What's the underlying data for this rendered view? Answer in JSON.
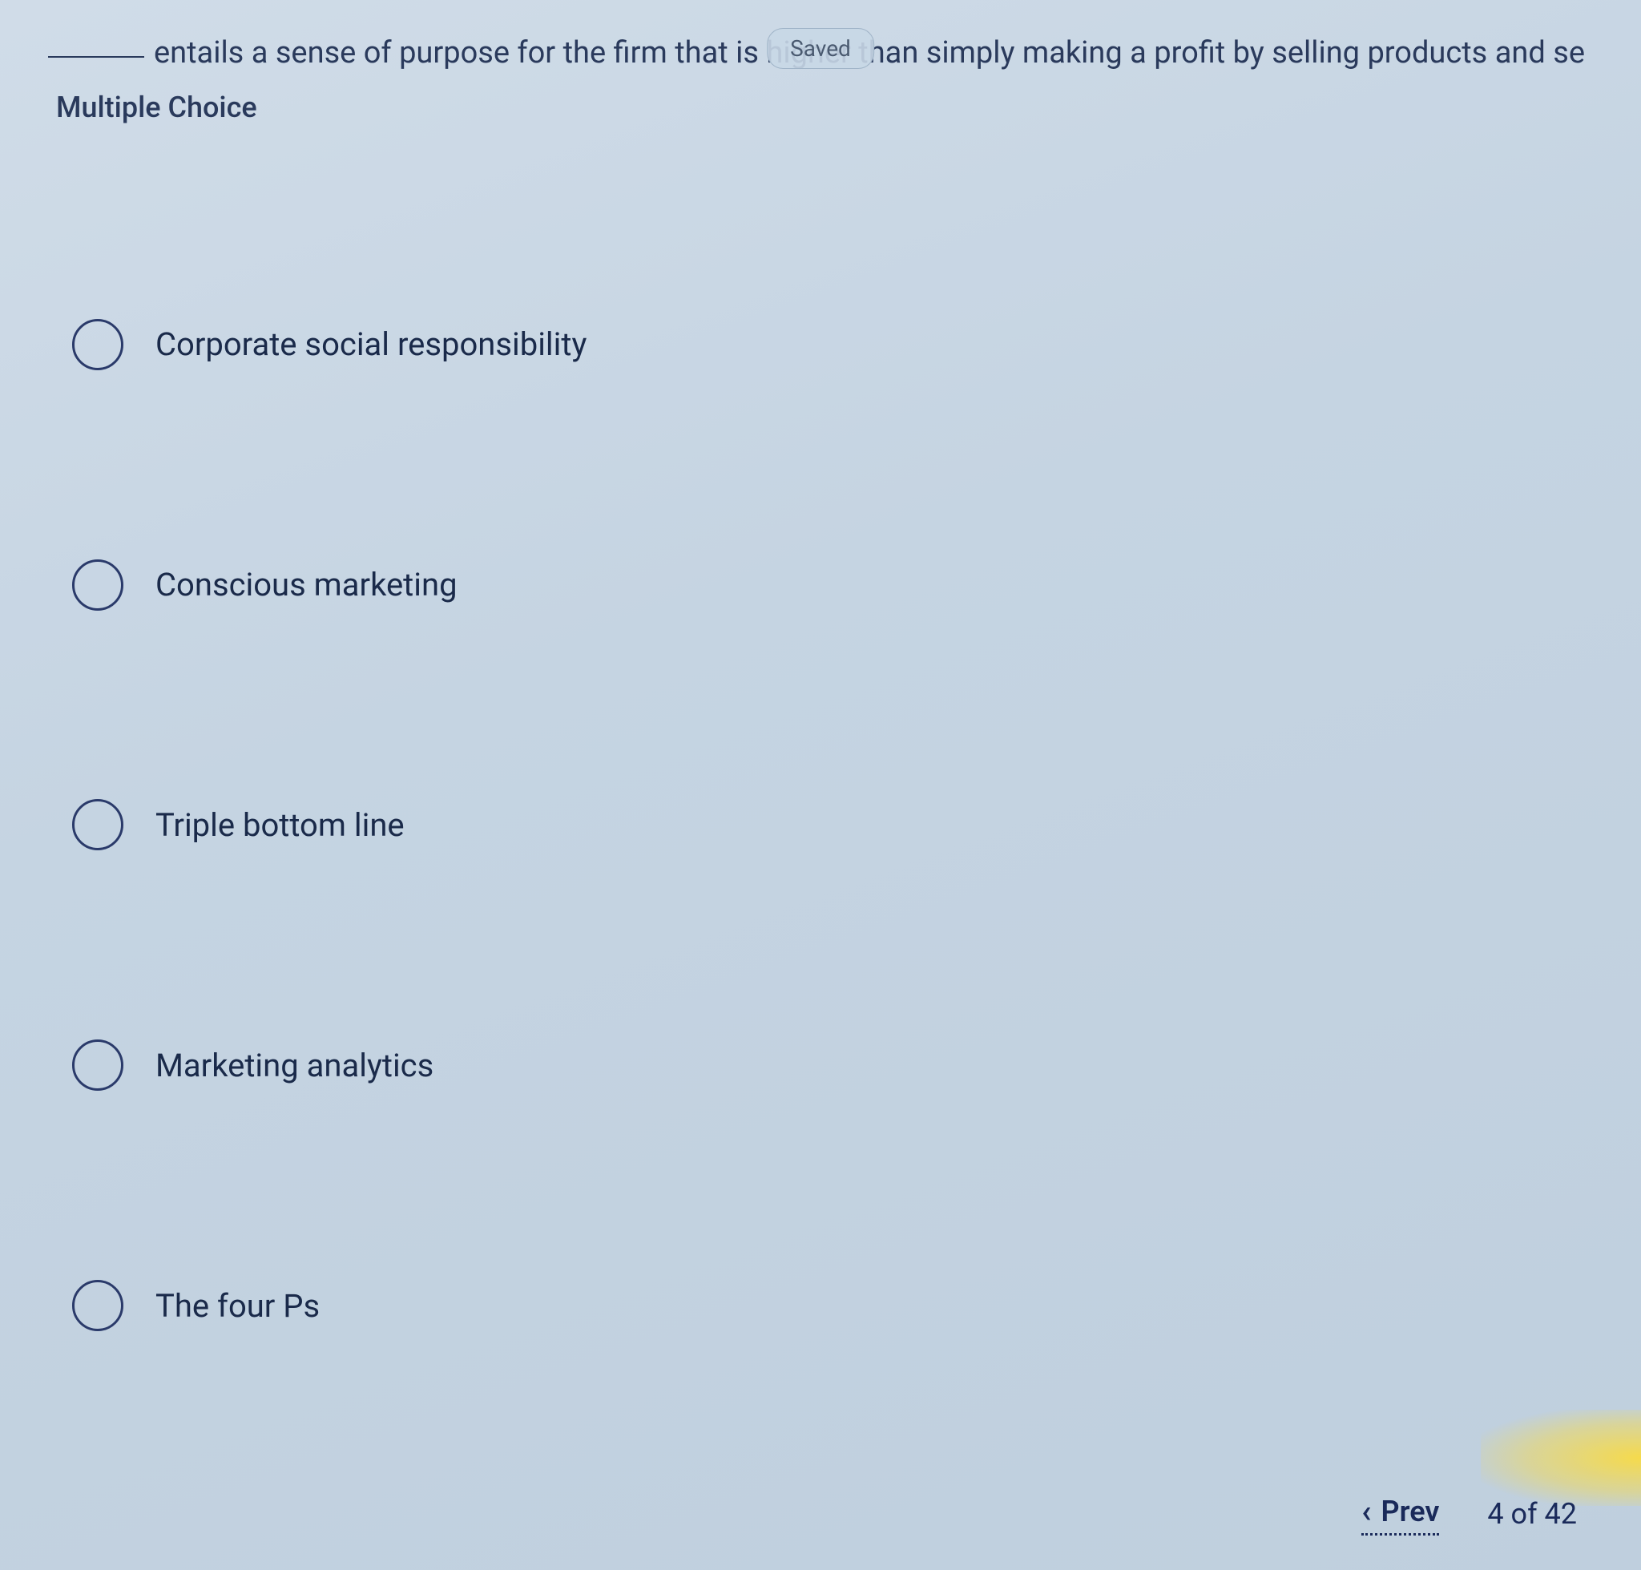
{
  "header": {
    "question_text_part1": "entails a sense of purpose for the firm that is higher than simply making a profit by selling products and se",
    "saved_label": "Saved",
    "question_type": "Multiple Choice"
  },
  "choices": [
    {
      "id": "choice_1",
      "label": "Corporate social responsibility",
      "selected": false,
      "partial": false
    },
    {
      "id": "choice_2",
      "label": "Conscious marketing",
      "selected": false,
      "partial": false
    },
    {
      "id": "choice_3",
      "label": "Triple bottom line",
      "selected": false,
      "partial": true
    },
    {
      "id": "choice_4",
      "label": "Marketing analytics",
      "selected": false,
      "partial": false
    },
    {
      "id": "choice_5",
      "label": "The four Ps",
      "selected": false,
      "partial": false
    }
  ],
  "navigation": {
    "prev_label": "Prev",
    "page_current": 4,
    "page_total": 42,
    "page_display": "4 of 42"
  }
}
